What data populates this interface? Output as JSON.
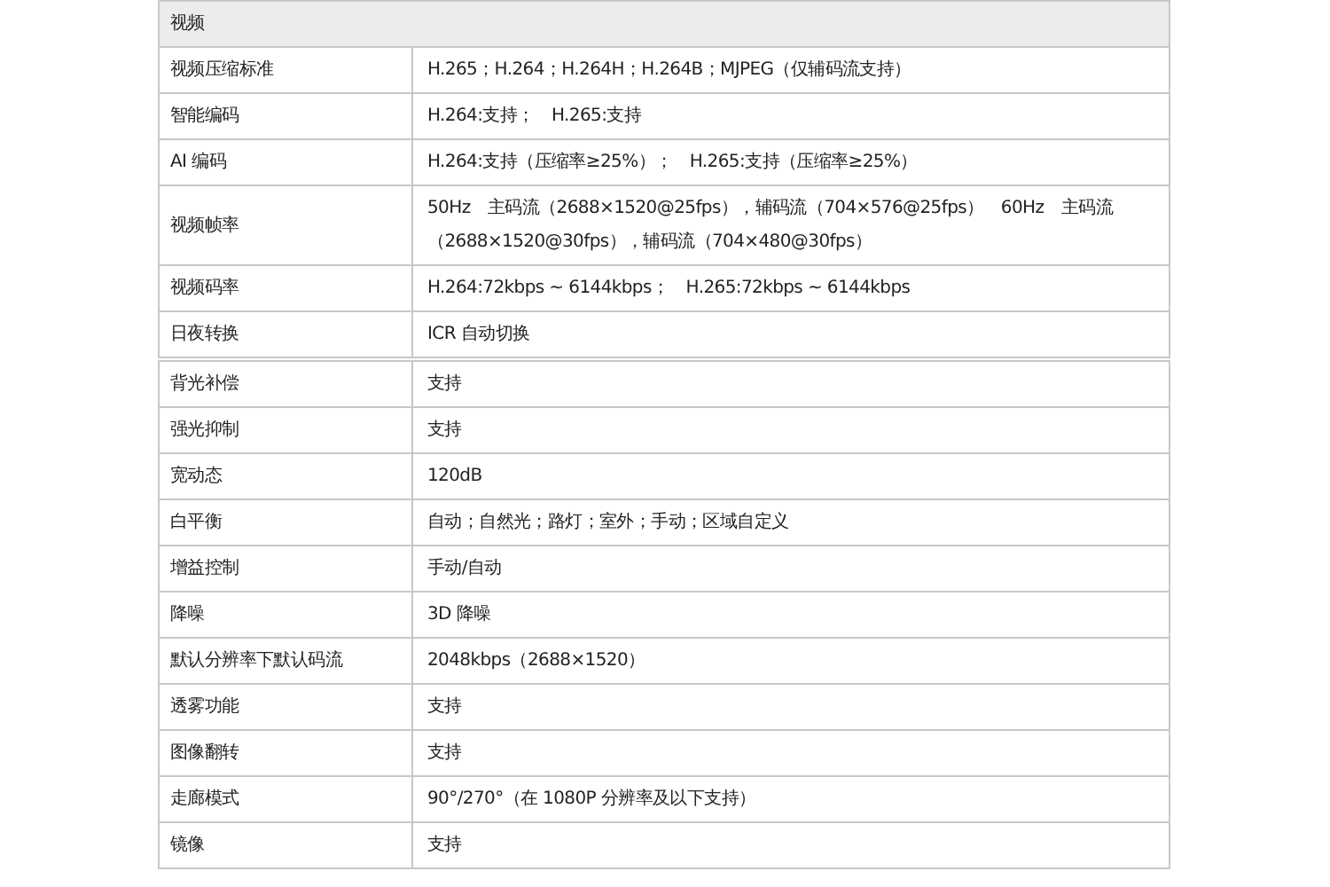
{
  "section_header": "视频",
  "table_1": {
    "rows": [
      {
        "label": "视频压缩标准",
        "value": "H.265；H.264；H.264H；H.264B；MJPEG（仅辅码流支持）"
      },
      {
        "label": "智能编码",
        "value": "H.264:支持；　H.265:支持"
      },
      {
        "label": "AI 编码",
        "value": "H.264:支持（压缩率≥25%）；　H.265:支持（压缩率≥25%）"
      },
      {
        "label": "视频帧率",
        "value": "50Hz　主码流（2688×1520@25fps），辅码流（704×576@25fps）　60Hz　主码流（2688×1520@30fps），辅码流（704×480@30fps）"
      },
      {
        "label": "视频码率",
        "value": "H.264:72kbps ~ 6144kbps；　H.265:72kbps ~ 6144kbps"
      },
      {
        "label": "日夜转换",
        "value": "ICR 自动切换"
      }
    ]
  },
  "table_2": {
    "rows": [
      {
        "label": "背光补偿",
        "value": "支持"
      },
      {
        "label": "强光抑制",
        "value": "支持"
      },
      {
        "label": "宽动态",
        "value": "120dB"
      },
      {
        "label": "白平衡",
        "value": "自动；自然光；路灯；室外；手动；区域自定义"
      },
      {
        "label": "增益控制",
        "value": "手动/自动"
      },
      {
        "label": "降噪",
        "value": "3D 降噪"
      },
      {
        "label": "默认分辨率下默认码流",
        "value": "2048kbps（2688×1520）"
      },
      {
        "label": "透雾功能",
        "value": "支持"
      },
      {
        "label": "图像翻转",
        "value": "支持"
      },
      {
        "label": "走廊模式",
        "value": "90°/270°（在 1080P 分辨率及以下支持）"
      },
      {
        "label": "镜像",
        "value": "支持"
      }
    ]
  }
}
